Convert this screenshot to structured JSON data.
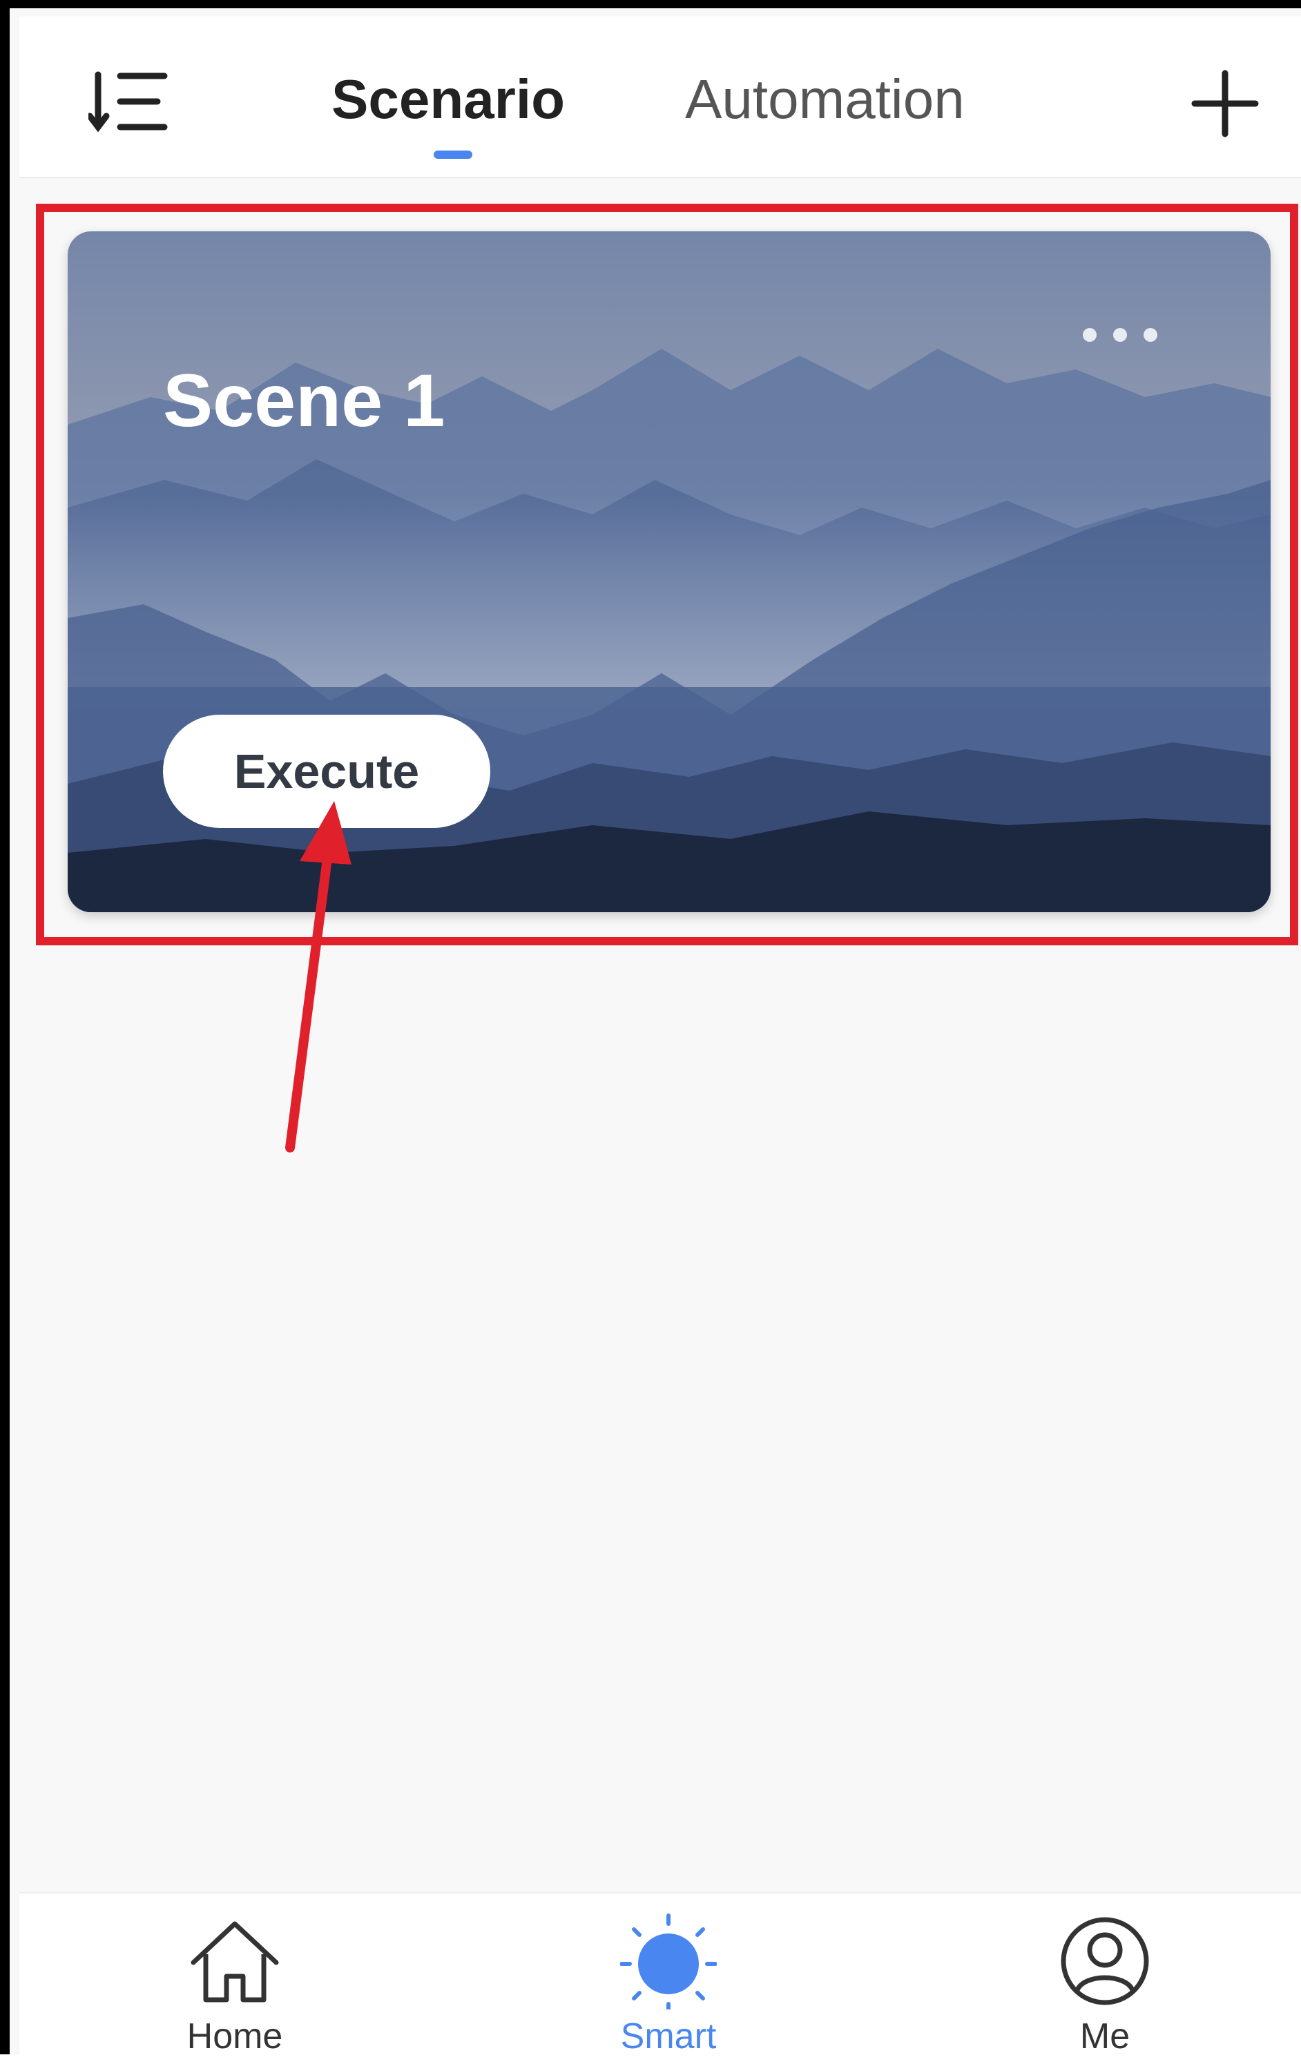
{
  "header": {
    "tabs": [
      {
        "label": "Scenario",
        "active": true
      },
      {
        "label": "Automation",
        "active": false
      }
    ],
    "sort_icon": "sort-list-icon",
    "add_icon": "plus-icon"
  },
  "scenes": [
    {
      "title": "Scene 1",
      "action_label": "Execute",
      "more_icon": "more-dots-icon"
    }
  ],
  "bottom_nav": {
    "items": [
      {
        "label": "Home",
        "icon": "home-icon",
        "active": false
      },
      {
        "label": "Smart",
        "icon": "sun-icon",
        "active": true
      },
      {
        "label": "Me",
        "icon": "user-circle-icon",
        "active": false
      }
    ]
  },
  "colors": {
    "accent": "#4a86f0",
    "annotation": "#e0202a"
  }
}
